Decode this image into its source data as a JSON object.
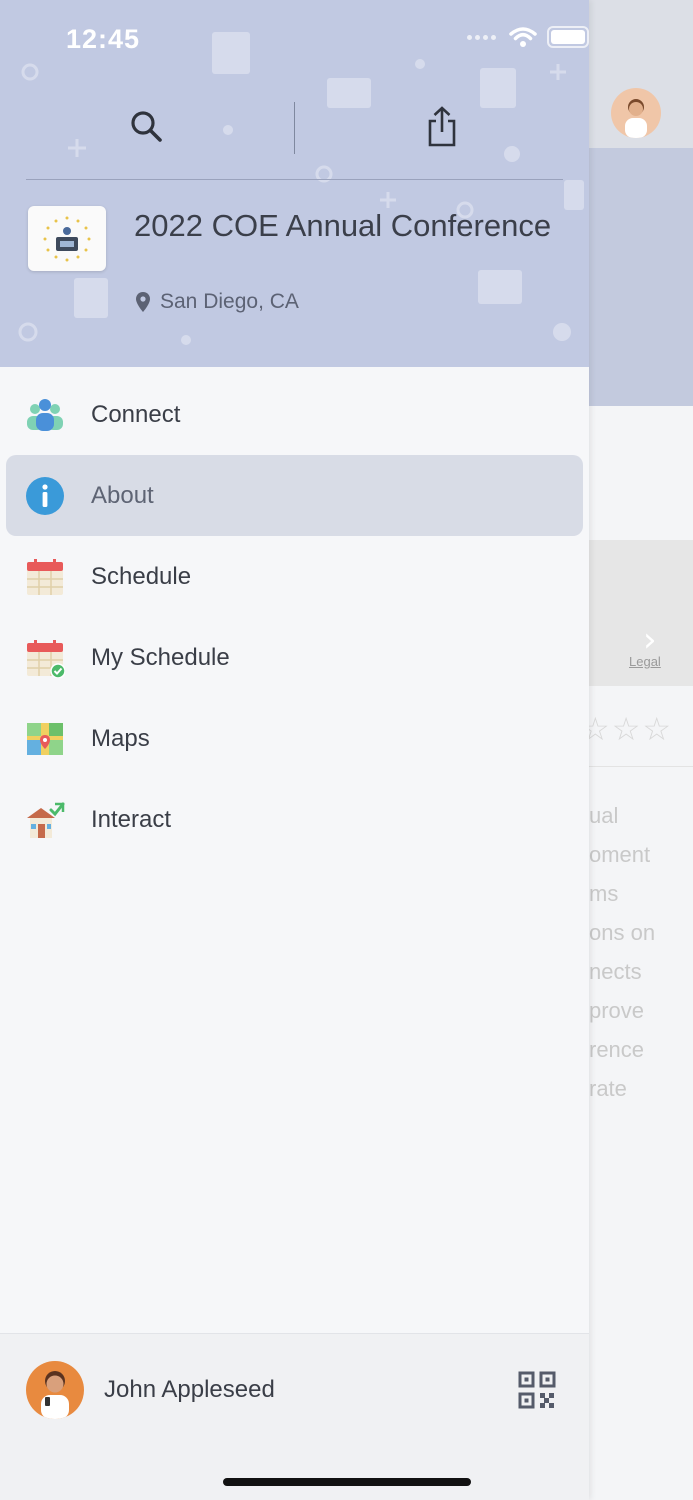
{
  "status_bar": {
    "time": "12:45"
  },
  "event": {
    "title": "2022 COE Annual Conference",
    "location": "San Diego, CA"
  },
  "menu": {
    "items": [
      {
        "label": "Connect",
        "icon": "people-icon"
      },
      {
        "label": "About",
        "icon": "info-icon",
        "active": true
      },
      {
        "label": "Schedule",
        "icon": "calendar-icon"
      },
      {
        "label": "My Schedule",
        "icon": "calendar-check-icon"
      },
      {
        "label": "Maps",
        "icon": "map-icon"
      },
      {
        "label": "Interact",
        "icon": "interact-icon"
      }
    ]
  },
  "footer": {
    "user_name": "John Appleseed"
  },
  "background_page": {
    "map_legal": "Legal",
    "text_lines": [
      "ual",
      "oment",
      "ms",
      "ons on",
      "nects",
      "prove",
      "rence",
      "rate"
    ]
  },
  "colors": {
    "header_bg": "#c1c9e2",
    "active_item_bg": "#d8dce6",
    "info_blue": "#3a9ad9"
  }
}
